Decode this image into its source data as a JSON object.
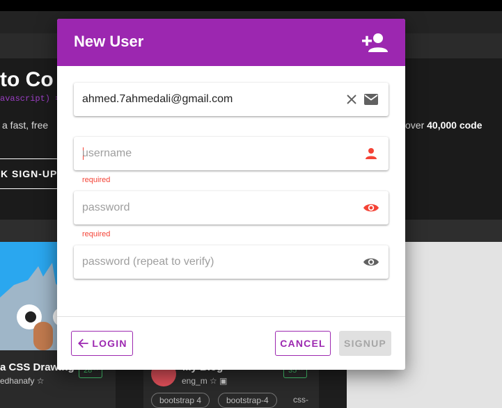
{
  "background": {
    "hero_title": "to Co",
    "hero_code": "avascript) =>",
    "hero_line_left": "a fast, free",
    "hero_line_right_prefix": "over",
    "hero_line_right_bold": "40,000 code",
    "signup_label": "K SIGN-UP",
    "card1_title": "a CSS Drawing",
    "card1_author": "edhanafy ☆",
    "card1_badge": "28 ^",
    "card2_title": "My Blog",
    "card2_author": "eng_m ☆ ▣",
    "card2_badge": "35 ^",
    "tags": [
      "bootstrap 4",
      "bootstrap-4",
      "css-"
    ]
  },
  "modal": {
    "title": "New User",
    "header_icon": "person-add-icon",
    "email": {
      "value": "ahmed.7ahmedali@gmail.com",
      "clear_icon": "close-icon",
      "icon": "email-icon"
    },
    "username": {
      "value": "",
      "placeholder": "username",
      "icon": "person-icon",
      "error": "required"
    },
    "password": {
      "value": "",
      "placeholder": "password",
      "icon": "eye-icon",
      "error": "required"
    },
    "password_repeat": {
      "value": "",
      "placeholder": "password (repeat to verify)",
      "icon": "eye-icon"
    },
    "footer": {
      "login_label": "LOGIN",
      "cancel_label": "CANCEL",
      "signup_label": "SIGNUP"
    }
  },
  "colors": {
    "accent": "#9c27b0",
    "error": "#f44336",
    "icon_neutral": "#616161",
    "disabled_bg": "#e0e0e0",
    "disabled_text": "#a6a6a6"
  }
}
